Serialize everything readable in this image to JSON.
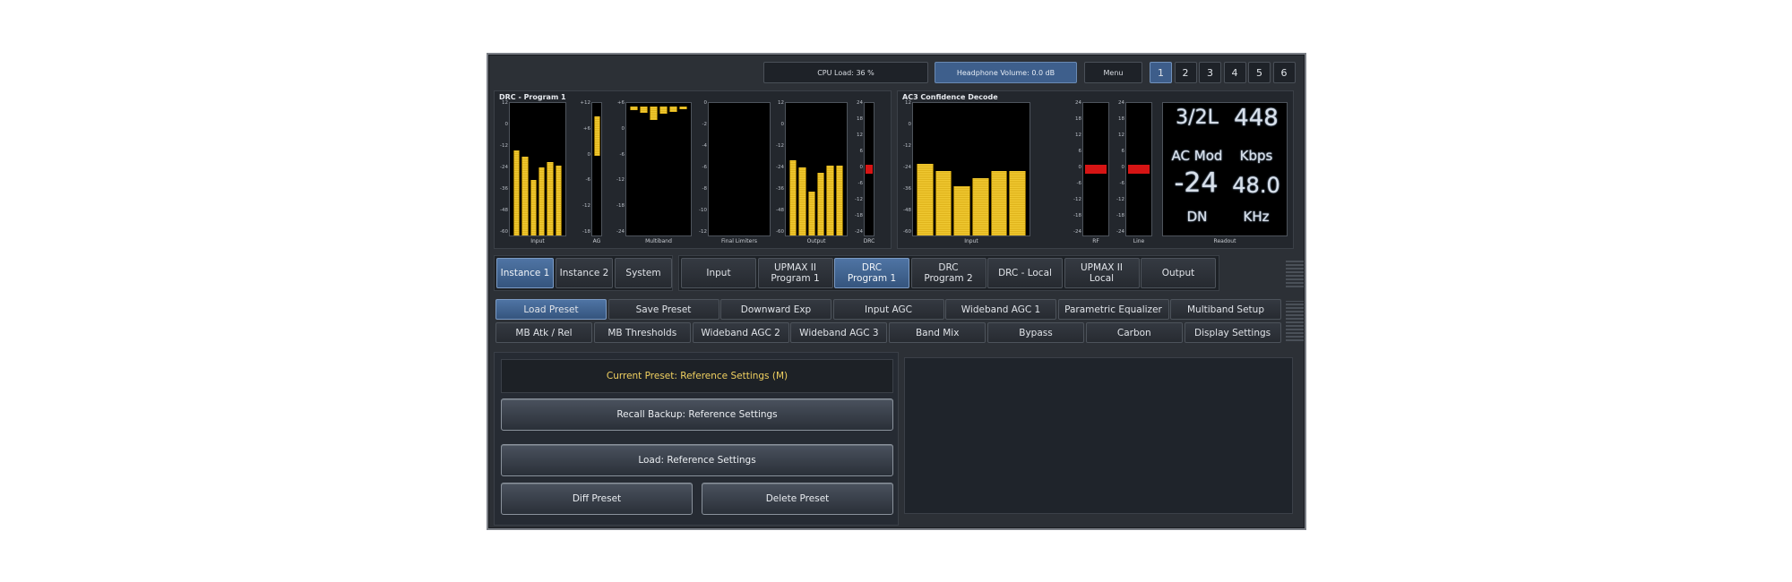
{
  "header": {
    "cpu_load": "CPU Load: 36 %",
    "headphone": "Headphone Volume: 0.0 dB",
    "menu": "Menu",
    "instances": [
      "1",
      "2",
      "3",
      "4",
      "5",
      "6"
    ]
  },
  "drc_panel": {
    "title": "DRC - Program 1",
    "input_ticks": [
      "12",
      "0",
      "-12",
      "-24",
      "-36",
      "-48",
      "-60"
    ],
    "input_levels_db": [
      -14,
      -17,
      -30,
      -23,
      -20,
      -22
    ],
    "ag_ticks": [
      "+12",
      "+6",
      "0",
      "-6",
      "-12",
      "-18"
    ],
    "ag_level": 9,
    "multiband_ticks": [
      "+6",
      "0",
      "-6",
      "-12",
      "-18",
      "-24"
    ],
    "multiband_gr": [
      2,
      4,
      11,
      5,
      3,
      1
    ],
    "fl_ticks": [
      "0",
      "-2",
      "-4",
      "-6",
      "-8",
      "-10",
      "-12"
    ],
    "output_ticks": [
      "12",
      "0",
      "-12",
      "-24",
      "-36",
      "-48",
      "-60"
    ],
    "output_levels_db": [
      -19,
      -23,
      -36,
      -26,
      -22,
      -22
    ],
    "drc_ticks": [
      "24",
      "18",
      "12",
      "6",
      "0",
      "-6",
      "-12",
      "-18",
      "-24"
    ],
    "drc_value": 0,
    "labels": {
      "input": "Input",
      "ag": "AG",
      "multiband": "Multiband",
      "final": "Final Limiters",
      "output": "Output",
      "drc": "DRC"
    }
  },
  "ac3_panel": {
    "title": "AC3 Confidence Decode",
    "input_ticks": [
      "12",
      "0",
      "-12",
      "-24",
      "-36",
      "-48",
      "-60"
    ],
    "input_levels_db": [
      -21,
      -25,
      -33,
      -29,
      -25,
      -25
    ],
    "rf_ticks": [
      "24",
      "18",
      "12",
      "6",
      "0",
      "-6",
      "-12",
      "-18",
      "-24"
    ],
    "rf_value": 0,
    "line_ticks": [
      "24",
      "18",
      "12",
      "6",
      "0",
      "-6",
      "-12",
      "-18",
      "-24"
    ],
    "line_value": 0,
    "labels": {
      "input": "Input",
      "rf": "RF",
      "line": "Line",
      "readout": "Readout"
    },
    "readout": {
      "mode": "3/2L",
      "bitrate": "448",
      "mode_label": "AC Mod",
      "bitrate_label": "Kbps",
      "dialnorm": "-24",
      "samplerate": "48.0",
      "dialnorm_label": "DN",
      "samplerate_label": "KHz"
    }
  },
  "nav_left": [
    "Instance 1",
    "Instance 2",
    "System"
  ],
  "nav_right": [
    [
      "Input"
    ],
    [
      "UPMAX II",
      "Program 1"
    ],
    [
      "DRC",
      "Program 1"
    ],
    [
      "DRC",
      "Program 2"
    ],
    [
      "DRC - Local"
    ],
    [
      "UPMAX II",
      "Local"
    ],
    [
      "Output"
    ]
  ],
  "sub_row1": [
    "Load Preset",
    "Save Preset",
    "Downward Exp",
    "Input AGC",
    "Wideband AGC 1",
    "Parametric Equalizer",
    "Multiband Setup"
  ],
  "sub_row2": [
    "MB Atk / Rel",
    "MB Thresholds",
    "Wideband AGC 2",
    "Wideband AGC 3",
    "Band Mix",
    "Bypass",
    "Carbon",
    "Display Settings"
  ],
  "preset": {
    "current": "Current Preset: Reference Settings (M)",
    "recall": "Recall Backup: Reference Settings",
    "load": "Load: Reference Settings",
    "diff": "Diff Preset",
    "delete": "Delete Preset"
  }
}
